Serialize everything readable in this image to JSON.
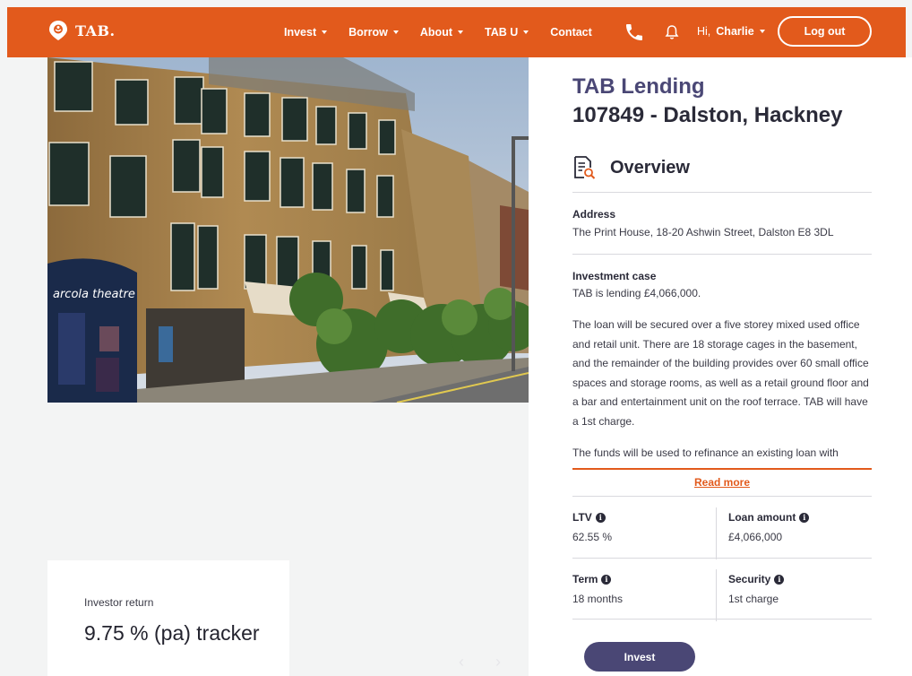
{
  "nav": {
    "brand": "TAB.",
    "menu": [
      {
        "label": "Invest"
      },
      {
        "label": "Borrow"
      },
      {
        "label": "About"
      },
      {
        "label": "TAB U"
      },
      {
        "label": "Contact"
      }
    ],
    "greeting_prefix": "Hi,",
    "user_name": "Charlie",
    "logout_label": "Log out",
    "brand_color": "#e25a1c"
  },
  "photo": {
    "signage": "arcola theatre"
  },
  "investor_return": {
    "label": "Investor return",
    "value": "9.75 % (pa) tracker"
  },
  "panel": {
    "lender": "TAB Lending",
    "loan_title": "107849 - Dalston, Hackney",
    "overview_title": "Overview",
    "address_label": "Address",
    "address_value": "The Print House, 18-20 Ashwin Street, Dalston E8 3DL",
    "case_label": "Investment case",
    "case_lead": "TAB is lending £4,066,000.",
    "case_paragraph_1": "The loan will be secured over a five storey mixed used office and retail unit. There are 18 storage cages in the basement, and the remainder of the building provides over 60 small office spaces and storage rooms, as well as a retail ground floor and a bar and entertainment unit on the roof terrace. TAB will have a 1st charge.",
    "case_paragraph_2": "The funds will be used to refinance an existing loan with",
    "read_more": "Read more",
    "stats": {
      "ltv_label": "LTV",
      "ltv_value": "62.55 %",
      "loan_amount_label": "Loan amount",
      "loan_amount_value": "£4,066,000",
      "term_label": "Term",
      "term_value": "18 months",
      "security_label": "Security",
      "security_value": "1st charge"
    },
    "invest_label": "Invest",
    "accent_color": "#4a4775"
  }
}
